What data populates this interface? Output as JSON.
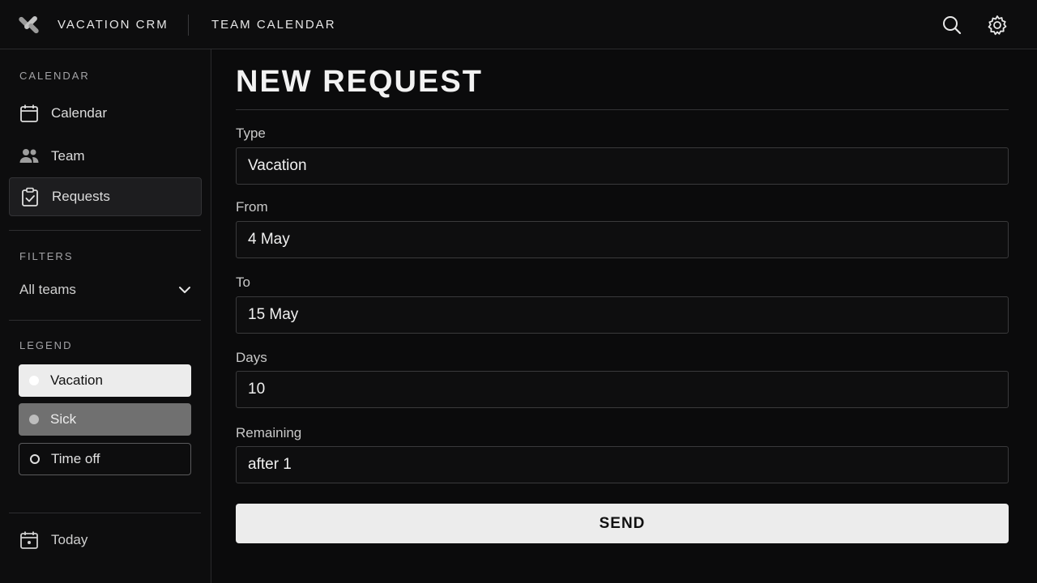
{
  "header": {
    "app_title": "VACATION CRM",
    "section_title": "TEAM CALENDAR",
    "icons": [
      "logo-icon",
      "search-icon",
      "gear-icon"
    ]
  },
  "sidebar": {
    "calendar_heading": "CALENDAR",
    "nav": [
      {
        "label": "Calendar",
        "icon": "calendar-icon",
        "active": false
      },
      {
        "label": "Team",
        "icon": "people-icon",
        "active": false
      },
      {
        "label": "Requests",
        "icon": "clipboard-check-icon",
        "active": true
      }
    ],
    "filters_heading": "FILTERS",
    "filter_value": "All teams",
    "legend_heading": "LEGEND",
    "legend": [
      {
        "label": "Vacation",
        "color": "#ececec"
      },
      {
        "label": "Sick",
        "color": "#707070"
      },
      {
        "label": "Time off",
        "color": "outline"
      }
    ],
    "today_label": "Today"
  },
  "main": {
    "title": "NEW REQUEST",
    "fields": [
      {
        "label": "Type",
        "value": "Vacation"
      },
      {
        "label": "From",
        "value": "4 May"
      },
      {
        "label": "To",
        "value": "15 May"
      },
      {
        "label": "Days",
        "value": "10"
      },
      {
        "label": "Remaining",
        "value": "after 1"
      }
    ],
    "send_label": "SEND"
  }
}
